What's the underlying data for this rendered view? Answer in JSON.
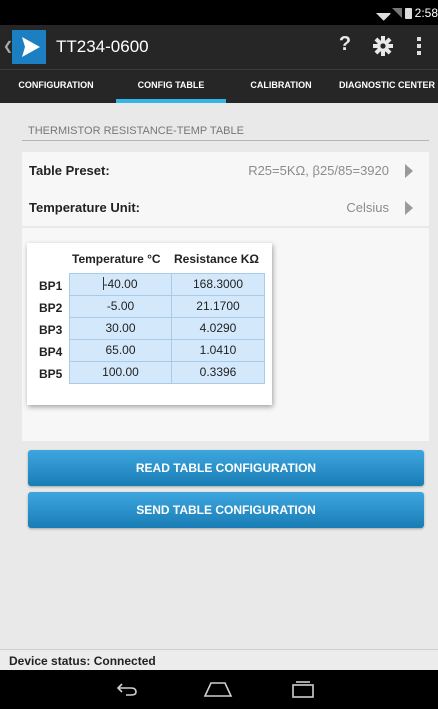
{
  "status_bar": {
    "time": "2:58"
  },
  "action_bar": {
    "title": "TT234-0600",
    "help_label": "?",
    "icons": [
      "back-arrow-icon",
      "app-logo",
      "help-icon",
      "gear-icon",
      "overflow-menu-icon"
    ]
  },
  "tabs": [
    {
      "label": "CONFIGURATION",
      "active": false
    },
    {
      "label": "CONFIG TABLE",
      "active": true
    },
    {
      "label": "CALIBRATION",
      "active": false
    },
    {
      "label": "DIAGNOSTIC CENTER",
      "active": false
    }
  ],
  "section": {
    "title": "THERMISTOR RESISTANCE-TEMP TABLE"
  },
  "table_preset": {
    "label": "Table Preset:",
    "value": "R25=5KΩ, β25/85=3920"
  },
  "temperature_unit": {
    "label": "Temperature Unit:",
    "value": "Celsius"
  },
  "thermistor_table": {
    "headers": [
      "Temperature °C",
      "Resistance KΩ"
    ],
    "rows": [
      {
        "bp": "BP1",
        "temp": "-40.00",
        "resistance": "168.3000"
      },
      {
        "bp": "BP2",
        "temp": "-5.00",
        "resistance": "21.1700"
      },
      {
        "bp": "BP3",
        "temp": "30.00",
        "resistance": "4.0290"
      },
      {
        "bp": "BP4",
        "temp": "65.00",
        "resistance": "1.0410"
      },
      {
        "bp": "BP5",
        "temp": "100.00",
        "resistance": "0.3396"
      }
    ]
  },
  "buttons": {
    "read": "READ TABLE CONFIGURATION",
    "send": "SEND TABLE CONFIGURATION"
  },
  "device_status": "Device status:  Connected",
  "colors": {
    "accent": "#33b5e5",
    "button_top": "#3ea6df",
    "button_bottom": "#1a7db5",
    "cell_fill": "#d3e9fb",
    "logo": "#1b7fc1"
  }
}
